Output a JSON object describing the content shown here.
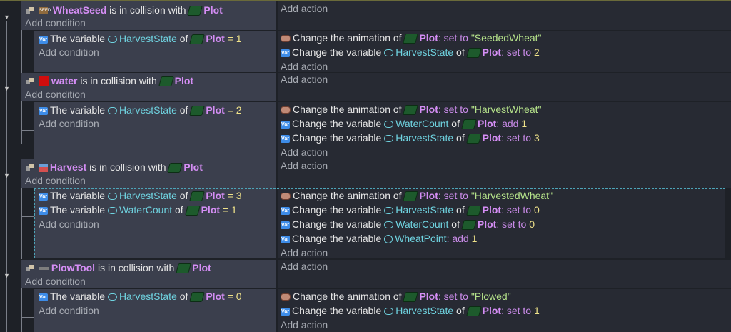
{
  "ui": {
    "add_action": "Add action",
    "add_condition": "Add condition",
    "is_in_collision_with": "is in collision with",
    "the_variable": "The variable",
    "change_the_variable": "Change the variable",
    "change_the_animation_of": "Change the animation of",
    "of": "of",
    "set_to": ": set to",
    "add": ": add",
    "eq": "="
  },
  "events": [
    {
      "object": "WheatSeed",
      "target": "Plot",
      "sub": {
        "conditions": [
          {
            "variable": "HarvestState",
            "object": "Plot",
            "value": "1"
          }
        ],
        "actions": [
          {
            "kind": "anim",
            "object": "Plot",
            "op": "set to",
            "value": "\"SeededWheat\""
          },
          {
            "kind": "var",
            "variable": "HarvestState",
            "object": "Plot",
            "op": "set to",
            "value": "2"
          }
        ]
      }
    },
    {
      "object": "water",
      "target": "Plot",
      "sub": {
        "conditions": [
          {
            "variable": "HarvestState",
            "object": "Plot",
            "value": "2"
          }
        ],
        "actions": [
          {
            "kind": "anim",
            "object": "Plot",
            "op": "set to",
            "value": "\"HarvestWheat\""
          },
          {
            "kind": "var",
            "variable": "WaterCount",
            "object": "Plot",
            "op": "add",
            "value": "1"
          },
          {
            "kind": "var",
            "variable": "HarvestState",
            "object": "Plot",
            "op": "set to",
            "value": "3"
          }
        ]
      }
    },
    {
      "object": "Harvest",
      "target": "Plot",
      "sub": {
        "conditions": [
          {
            "variable": "HarvestState",
            "object": "Plot",
            "value": "3"
          },
          {
            "variable": "WaterCount",
            "object": "Plot",
            "value": "1"
          }
        ],
        "actions": [
          {
            "kind": "anim",
            "object": "Plot",
            "op": "set to",
            "value": "\"HarvestedWheat\""
          },
          {
            "kind": "var",
            "variable": "HarvestState",
            "object": "Plot",
            "op": "set to",
            "value": "0"
          },
          {
            "kind": "var",
            "variable": "WaterCount",
            "object": "Plot",
            "op": "set to",
            "value": "0"
          },
          {
            "kind": "global",
            "variable": "WheatPoint",
            "op": "add",
            "value": "1"
          }
        ]
      }
    },
    {
      "object": "PlowTool",
      "target": "Plot",
      "sub": {
        "conditions": [
          {
            "variable": "HarvestState",
            "object": "Plot",
            "value": "0"
          }
        ],
        "actions": [
          {
            "kind": "anim",
            "object": "Plot",
            "op": "set to",
            "value": "\"Plowed\""
          },
          {
            "kind": "var",
            "variable": "HarvestState",
            "object": "Plot",
            "op": "set to",
            "value": "1"
          }
        ]
      }
    }
  ]
}
